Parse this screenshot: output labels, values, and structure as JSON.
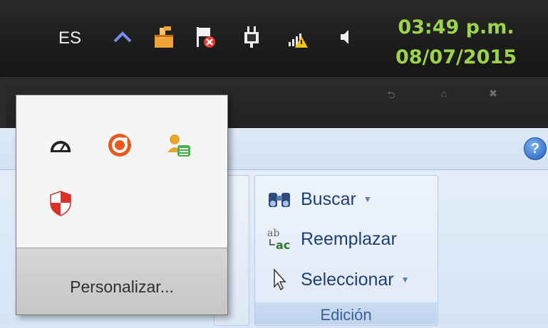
{
  "taskbar": {
    "language": "ES",
    "time": "03:49 p.m.",
    "date": "08/07/2015",
    "tray_icons": [
      "chevron-up-icon",
      "network-share-icon",
      "action-center-flag-icon",
      "power-plug-icon",
      "wifi-warning-icon",
      "speaker-icon"
    ]
  },
  "window": {
    "controls": [
      "restore-icon",
      "settings-icon",
      "close-icon"
    ]
  },
  "tray_overflow": {
    "icons": [
      "speedometer-icon",
      "orange-circle-app-icon",
      "users-stack-icon",
      "security-shield-icon"
    ],
    "customize_label": "Personalizar..."
  },
  "ribbon": {
    "help_label": "?",
    "edit_group": {
      "title": "Edición",
      "find_label": "Buscar",
      "replace_label": "Reemplazar",
      "select_label": "Seleccionar"
    }
  },
  "colors": {
    "clock_green": "#9cd34a",
    "ribbon_text": "#1f3f73",
    "taskbar_bg": "#1c1c1c"
  }
}
